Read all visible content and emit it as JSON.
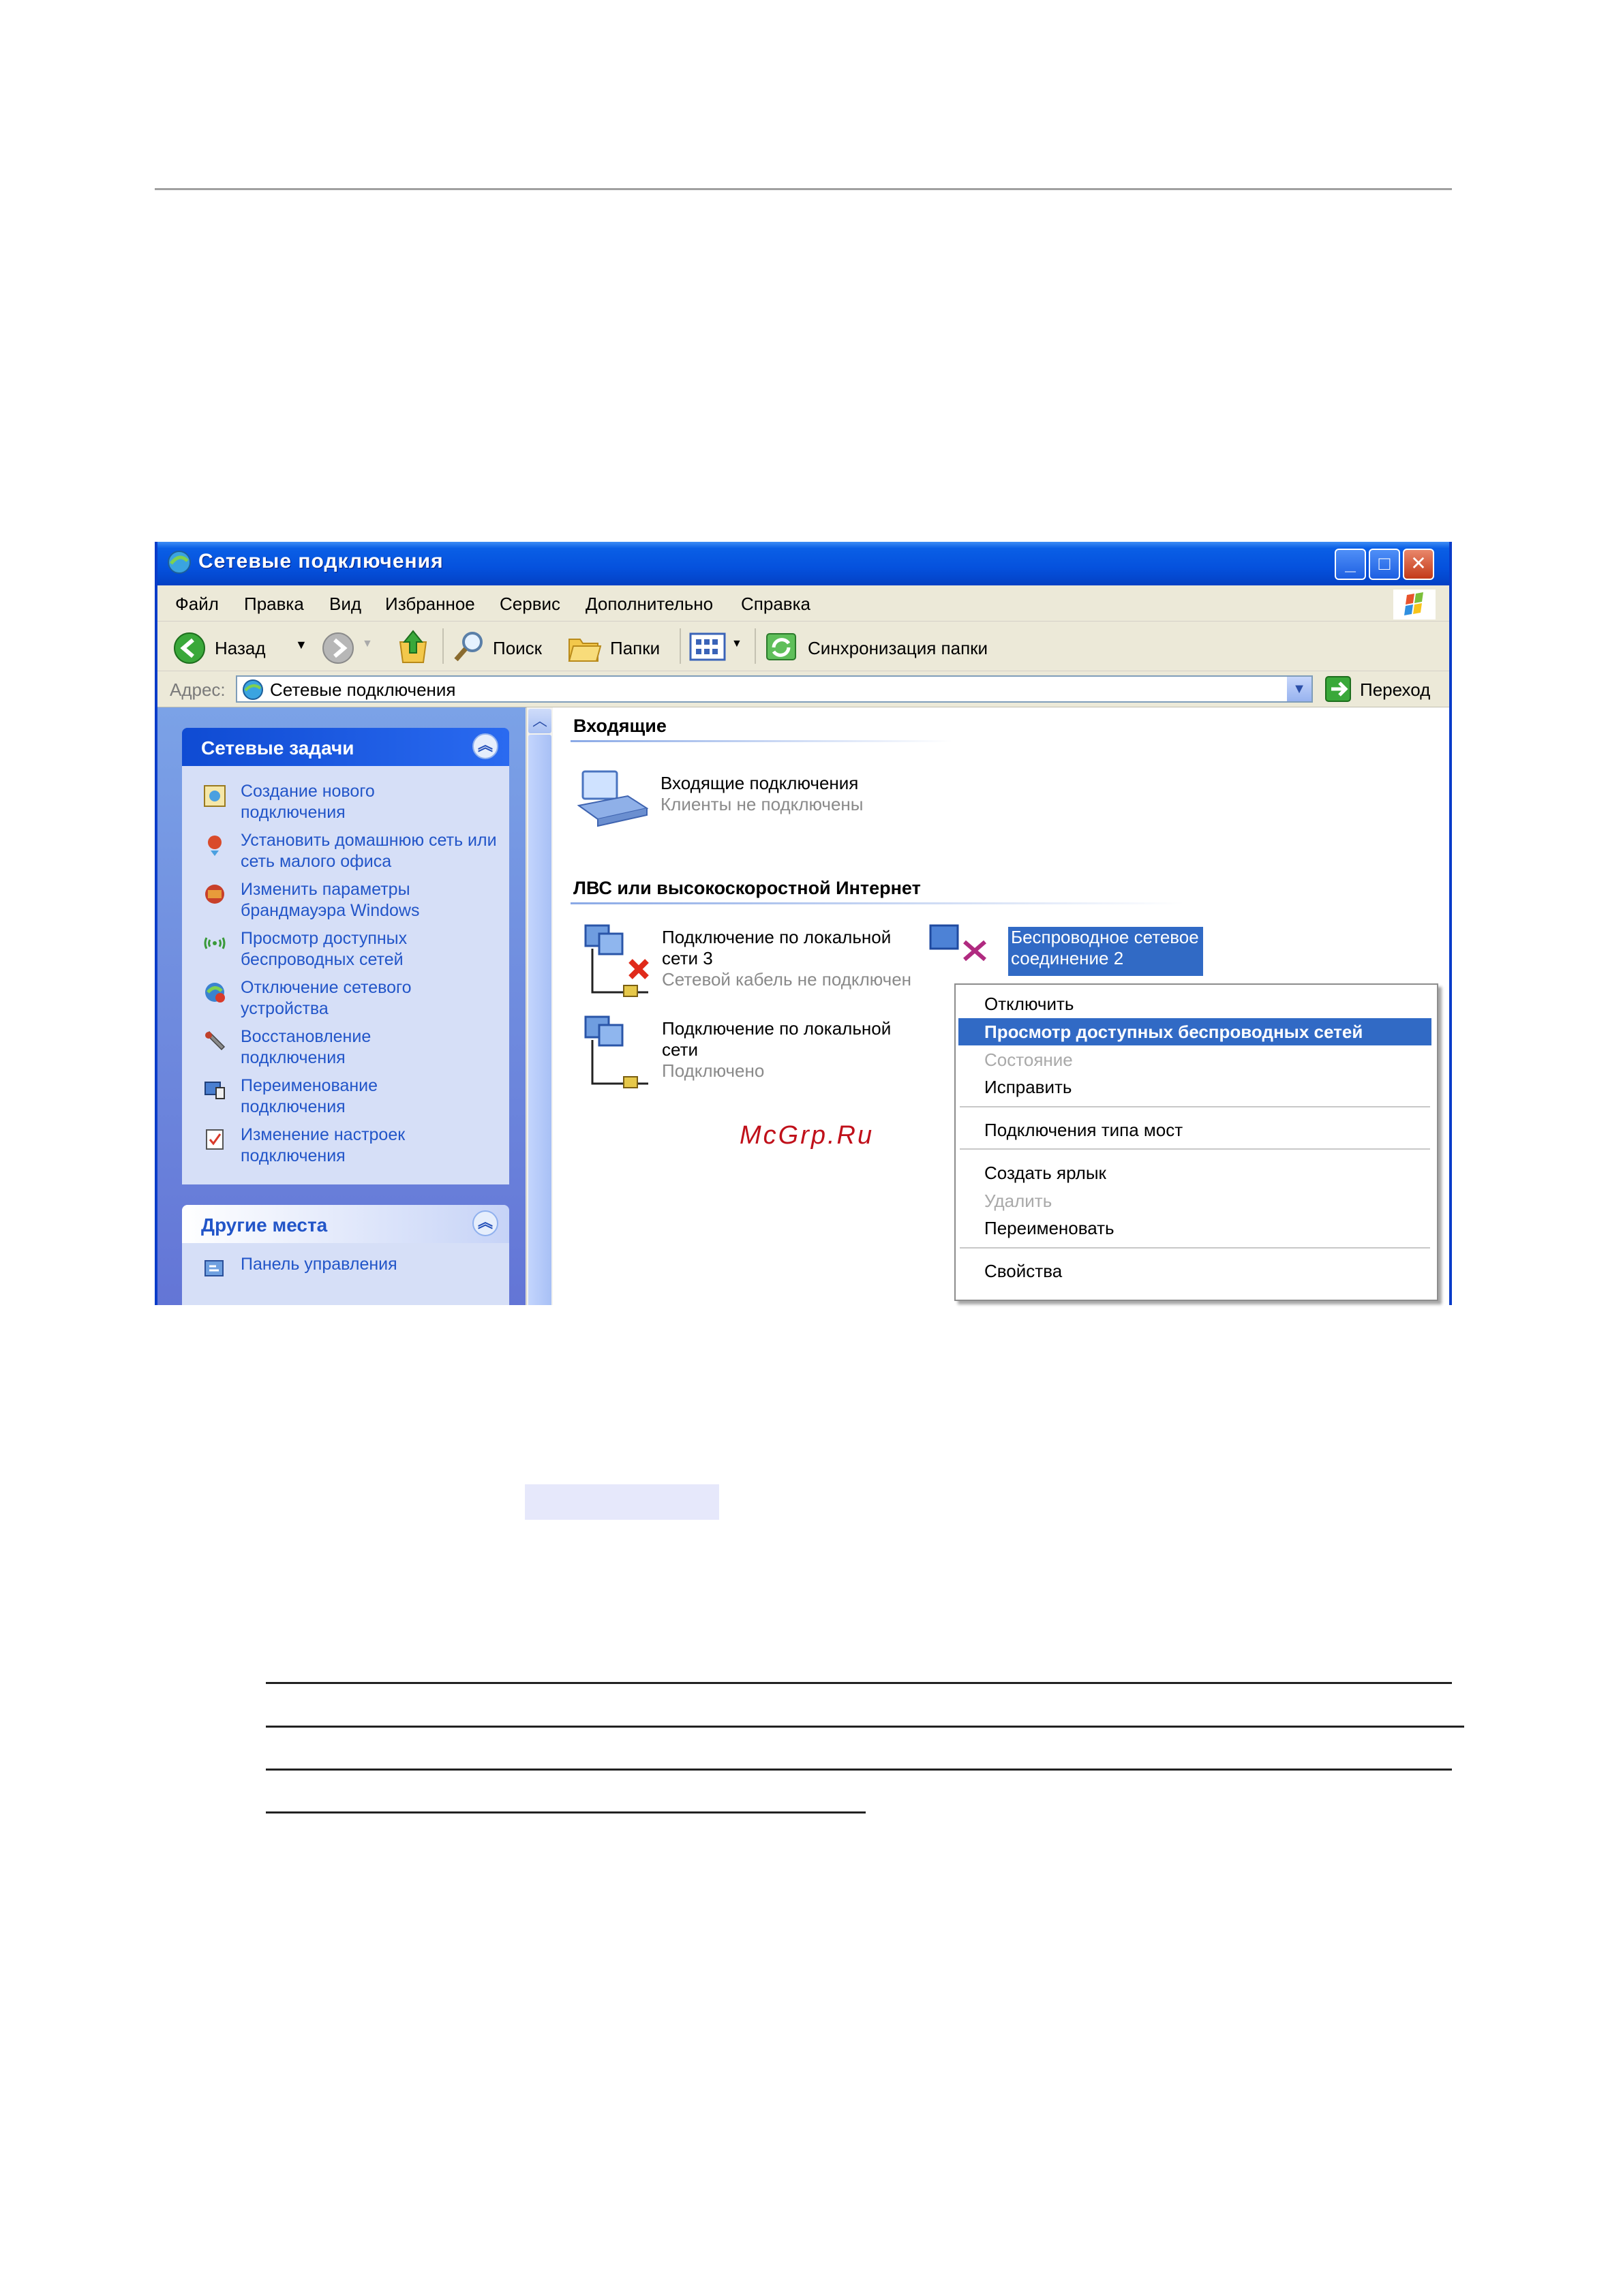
{
  "window": {
    "title": "Сетевые подключения",
    "menu": [
      "Файл",
      "Правка",
      "Вид",
      "Избранное",
      "Сервис",
      "Дополнительно",
      "Справка"
    ],
    "toolbar": {
      "back": "Назад",
      "search": "Поиск",
      "folders": "Папки",
      "sync": "Синхронизация папки"
    },
    "address": {
      "label": "Адрес:",
      "value": "Сетевые подключения",
      "go": "Переход"
    }
  },
  "sidebar": {
    "tasks_title": "Сетевые задачи",
    "tasks": [
      "Создание нового подключения",
      "Установить домашнюю сеть или сеть малого офиса",
      "Изменить параметры брандмауэра Windows",
      "Просмотр доступных беспроводных сетей",
      "Отключение сетевого устройства",
      "Восстановление подключения",
      "Переименование подключения",
      "Изменение настроек подключения"
    ],
    "other_title": "Другие места",
    "other_items": [
      "Панель управления"
    ]
  },
  "content": {
    "group_incoming": "Входящие",
    "incoming": {
      "title": "Входящие подключения",
      "status": "Клиенты не подключены"
    },
    "group_lan": "ЛВС или высокоскоростной Интернет",
    "lan3": {
      "title": "Подключение по локальной сети 3",
      "status": "Сетевой кабель не подключен"
    },
    "lan": {
      "title": "Подключение по локальной сети",
      "status": "Подключено"
    },
    "wireless": {
      "title": "Беспроводное сетевое соединение 2"
    }
  },
  "context_menu": {
    "items": [
      {
        "label": "Отключить",
        "state": "normal"
      },
      {
        "label": "Просмотр доступных беспроводных сетей",
        "state": "selected"
      },
      {
        "label": "Состояние",
        "state": "disabled"
      },
      {
        "label": "Исправить",
        "state": "normal"
      },
      {
        "label": "Подключения типа мост",
        "state": "normal"
      },
      {
        "label": "Создать ярлык",
        "state": "normal"
      },
      {
        "label": "Удалить",
        "state": "disabled"
      },
      {
        "label": "Переименовать",
        "state": "normal"
      },
      {
        "label": "Свойства",
        "state": "normal"
      }
    ]
  },
  "watermark": "McGrp.Ru",
  "colors": {
    "titlebar": "#0551dd",
    "selection": "#316ac5",
    "link": "#2255c8",
    "watermark": "#c0101a"
  }
}
